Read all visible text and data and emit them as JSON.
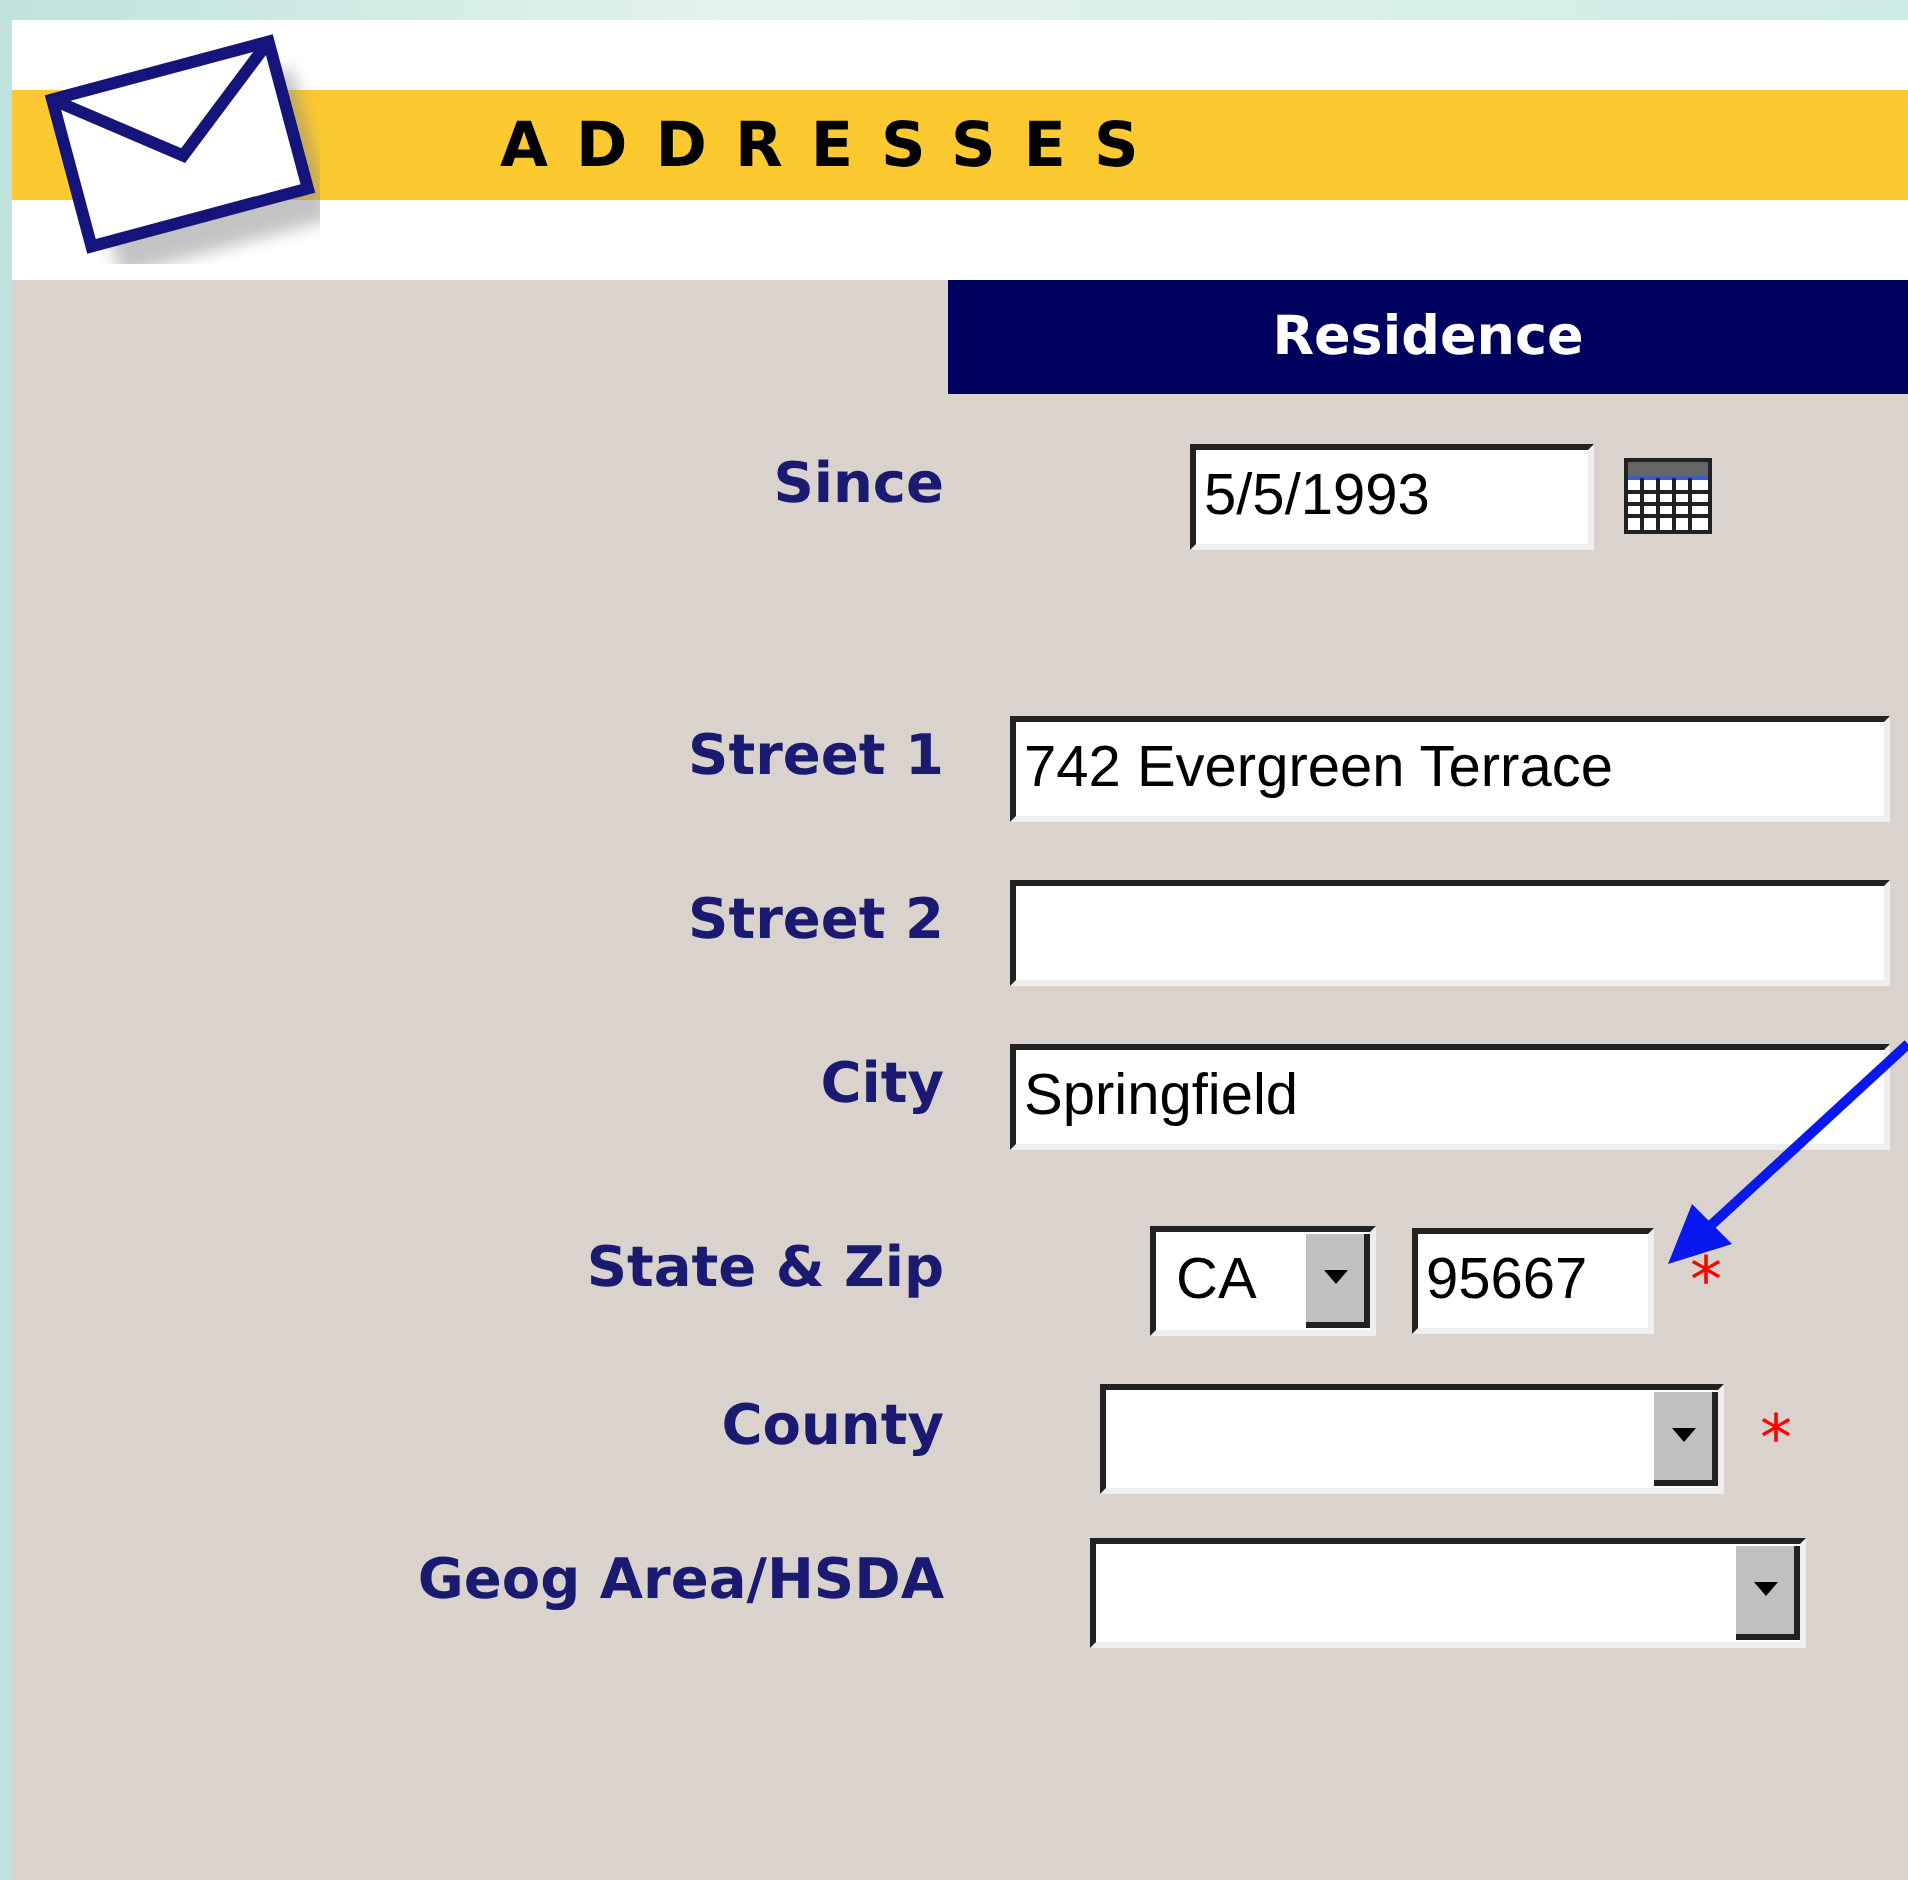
{
  "header": {
    "title": "ADDRESSES"
  },
  "section": {
    "title": "Residence"
  },
  "fields": [
    {
      "kind": "date",
      "label": "Since",
      "value": "5/5/1993"
    },
    {
      "kind": "text",
      "label": "Street 1",
      "value": "742 Evergreen Terrace"
    },
    {
      "kind": "text",
      "label": "Street 2"
    },
    {
      "kind": "text",
      "label": "City",
      "value": "Springfield"
    },
    {
      "kind": "state_zip",
      "label": "State & Zip",
      "state": "CA",
      "zip": "95667",
      "required_mark": "*"
    },
    {
      "kind": "select",
      "label": "County",
      "required_mark": "*"
    },
    {
      "kind": "select",
      "label": "Geog Area/HSDA"
    }
  ]
}
